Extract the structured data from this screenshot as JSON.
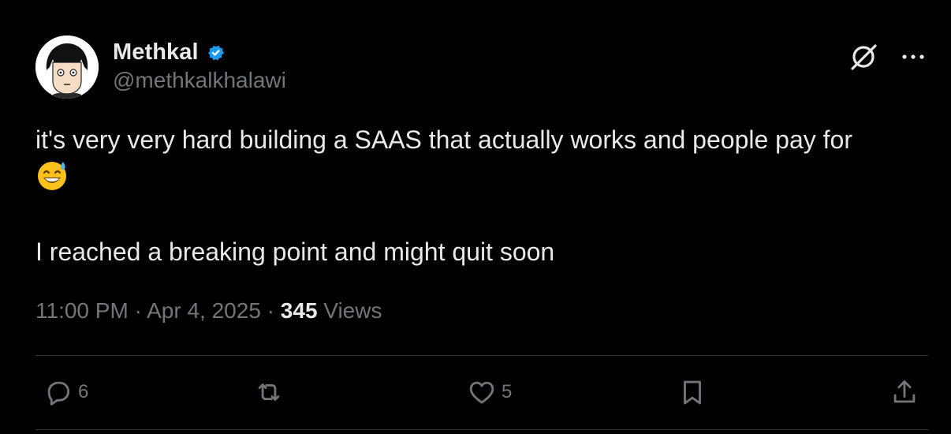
{
  "author": {
    "name": "Methkal",
    "handle": "@methkalkhalawi",
    "verified": true,
    "avatar": "avatar-illustration"
  },
  "icons": {
    "verified": "verified-badge-icon",
    "grok": "grok-icon",
    "more": "more-options-icon",
    "reply": "reply-icon",
    "retweet": "retweet-icon",
    "like": "like-icon",
    "bookmark": "bookmark-icon",
    "share": "share-icon"
  },
  "tweet": {
    "line1": "it's very very hard building a SAAS that actually works and people pay for",
    "emoji": "😅",
    "line2": "I reached a breaking point and might quit soon"
  },
  "meta": {
    "time": "11:00 PM",
    "separator1": " · ",
    "date": "Apr 4, 2025",
    "separator2": " · ",
    "views_count": "345",
    "views_label": " Views"
  },
  "actions": {
    "reply_count": "6",
    "like_count": "5"
  },
  "colors": {
    "background": "#000000",
    "text": "#e7e9ea",
    "secondary": "#71767b",
    "verified": "#1d9bf0",
    "divider": "#2f3336"
  }
}
